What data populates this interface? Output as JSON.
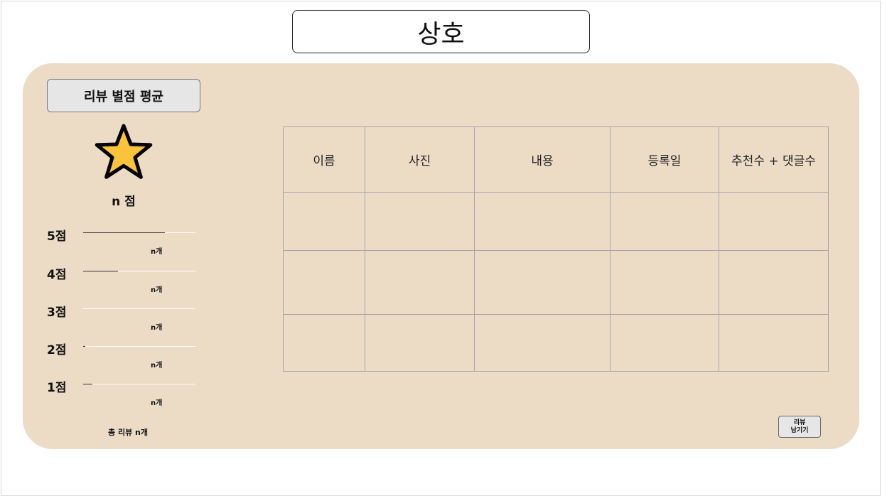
{
  "store_title": "상호",
  "summary": {
    "avg_label": "리뷰 별점 평균",
    "score_text": "n 점",
    "star_color": "#f9c33a",
    "ratings": [
      {
        "label": "5점",
        "count": "n개",
        "fill": 0.73
      },
      {
        "label": "4점",
        "count": "n개",
        "fill": 0.31
      },
      {
        "label": "3점",
        "count": "n개",
        "fill": 0.0
      },
      {
        "label": "2점",
        "count": "n개",
        "fill": 0.02
      },
      {
        "label": "1점",
        "count": "n개",
        "fill": 0.08
      }
    ],
    "total": "총 리뷰 n개"
  },
  "table": {
    "headers": [
      "이름",
      "사진",
      "내용",
      "등록일",
      "추천수 + 댓글수"
    ],
    "rows": [
      [
        "",
        "",
        "",
        "",
        ""
      ],
      [
        "",
        "",
        "",
        "",
        ""
      ],
      [
        "",
        "",
        "",
        "",
        ""
      ]
    ]
  },
  "write_button": "리뷰\n남기기"
}
